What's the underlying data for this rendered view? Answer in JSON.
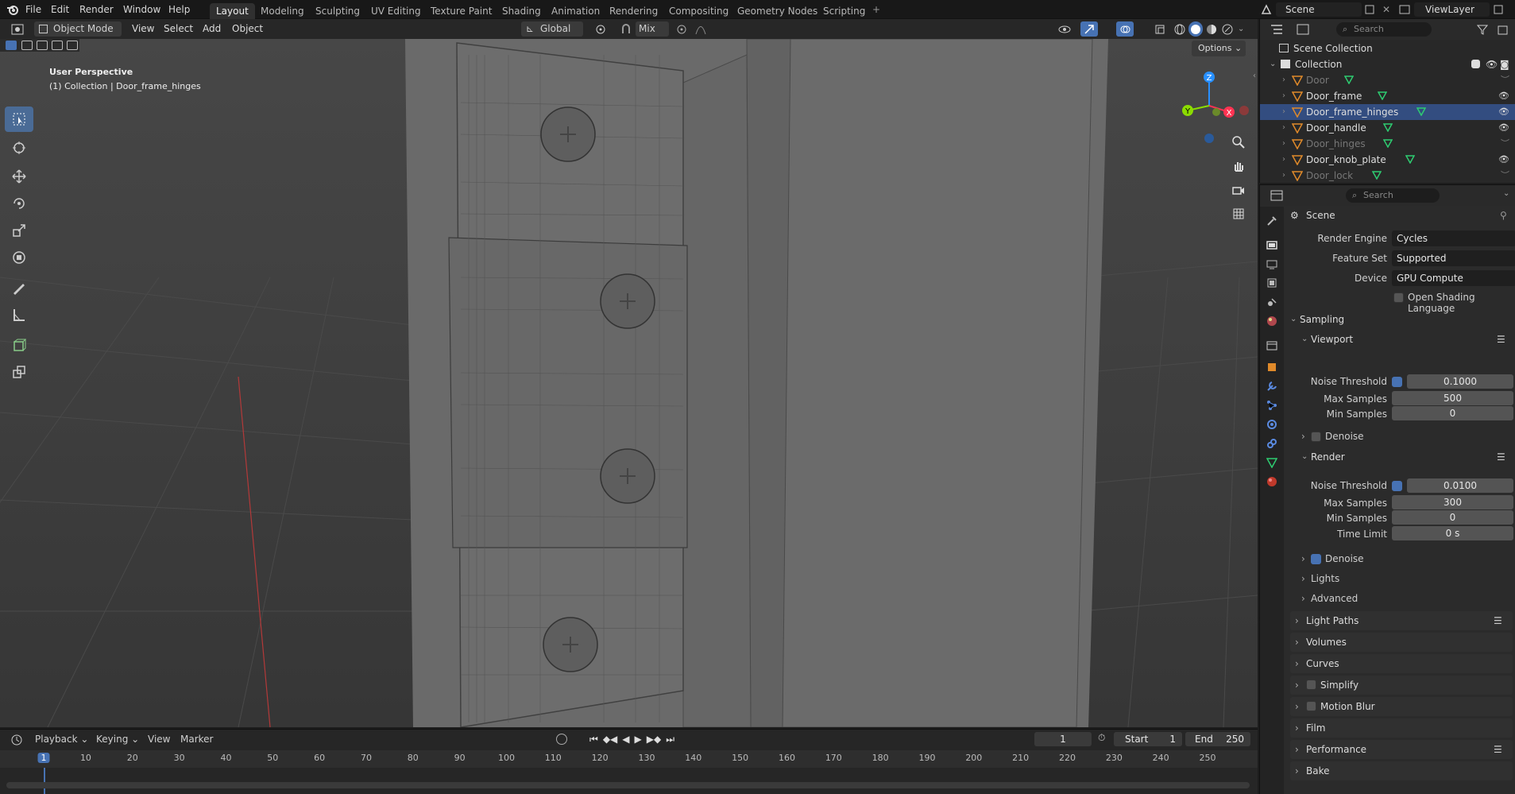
{
  "topbar": {
    "menus": [
      "File",
      "Edit",
      "Render",
      "Window",
      "Help"
    ],
    "workspaces": [
      "Layout",
      "Modeling",
      "Sculpting",
      "UV Editing",
      "Texture Paint",
      "Shading",
      "Animation",
      "Rendering",
      "Compositing",
      "Geometry Nodes",
      "Scripting"
    ],
    "active_workspace": "Layout",
    "scene_name": "Scene",
    "view_layer": "ViewLayer"
  },
  "viewport_header": {
    "mode": "Object Mode",
    "menus": [
      "View",
      "Select",
      "Add",
      "Object"
    ],
    "orientation": "Global",
    "snap_mode": "Mix",
    "options_label": "Options"
  },
  "viewport": {
    "perspective_label": "User Perspective",
    "context_label": "(1) Collection | Door_frame_hinges",
    "gizmo": {
      "x": "X",
      "y": "Y",
      "z": "Z"
    }
  },
  "timeline": {
    "menus": [
      "Playback",
      "Keying",
      "View",
      "Marker"
    ],
    "current_frame": "1",
    "start_label": "Start",
    "start": "1",
    "end_label": "End",
    "end": "250",
    "ruler": [
      "1",
      "10",
      "20",
      "30",
      "40",
      "50",
      "60",
      "70",
      "80",
      "90",
      "100",
      "110",
      "120",
      "130",
      "140",
      "150",
      "160",
      "170",
      "180",
      "190",
      "200",
      "210",
      "220",
      "230",
      "240",
      "250"
    ]
  },
  "outliner": {
    "search_placeholder": "Search",
    "scene_collection": "Scene Collection",
    "collection": "Collection",
    "objects": [
      {
        "name": "Door",
        "hidden": true
      },
      {
        "name": "Door_frame",
        "hidden": false
      },
      {
        "name": "Door_frame_hinges",
        "hidden": false,
        "selected": true
      },
      {
        "name": "Door_handle",
        "hidden": false
      },
      {
        "name": "Door_hinges",
        "hidden": true
      },
      {
        "name": "Door_knob_plate",
        "hidden": false
      },
      {
        "name": "Door_lock",
        "hidden": true
      }
    ]
  },
  "properties": {
    "search_placeholder": "Search",
    "context": "Scene",
    "render_engine_label": "Render Engine",
    "render_engine": "Cycles",
    "feature_set_label": "Feature Set",
    "feature_set": "Supported",
    "device_label": "Device",
    "device": "GPU Compute",
    "osl_label": "Open Shading Language",
    "sampling": {
      "title": "Sampling",
      "viewport": {
        "title": "Viewport",
        "noise_threshold_label": "Noise Threshold",
        "noise_threshold": "0.1000",
        "max_samples_label": "Max Samples",
        "max_samples": "500",
        "min_samples_label": "Min Samples",
        "min_samples": "0",
        "denoise_label": "Denoise"
      },
      "render": {
        "title": "Render",
        "noise_threshold_label": "Noise Threshold",
        "noise_threshold": "0.0100",
        "max_samples_label": "Max Samples",
        "max_samples": "300",
        "min_samples_label": "Min Samples",
        "min_samples": "0",
        "time_limit_label": "Time Limit",
        "time_limit": "0 s",
        "denoise_label": "Denoise"
      },
      "lights": "Lights",
      "advanced": "Advanced"
    },
    "panels": [
      "Light Paths",
      "Volumes",
      "Curves",
      "Simplify",
      "Motion Blur",
      "Film",
      "Performance",
      "Bake"
    ]
  },
  "colors": {
    "accent": "#4772b3",
    "axis_x": "#ff3352",
    "axis_y": "#8bdc00",
    "axis_z": "#2890ff"
  }
}
